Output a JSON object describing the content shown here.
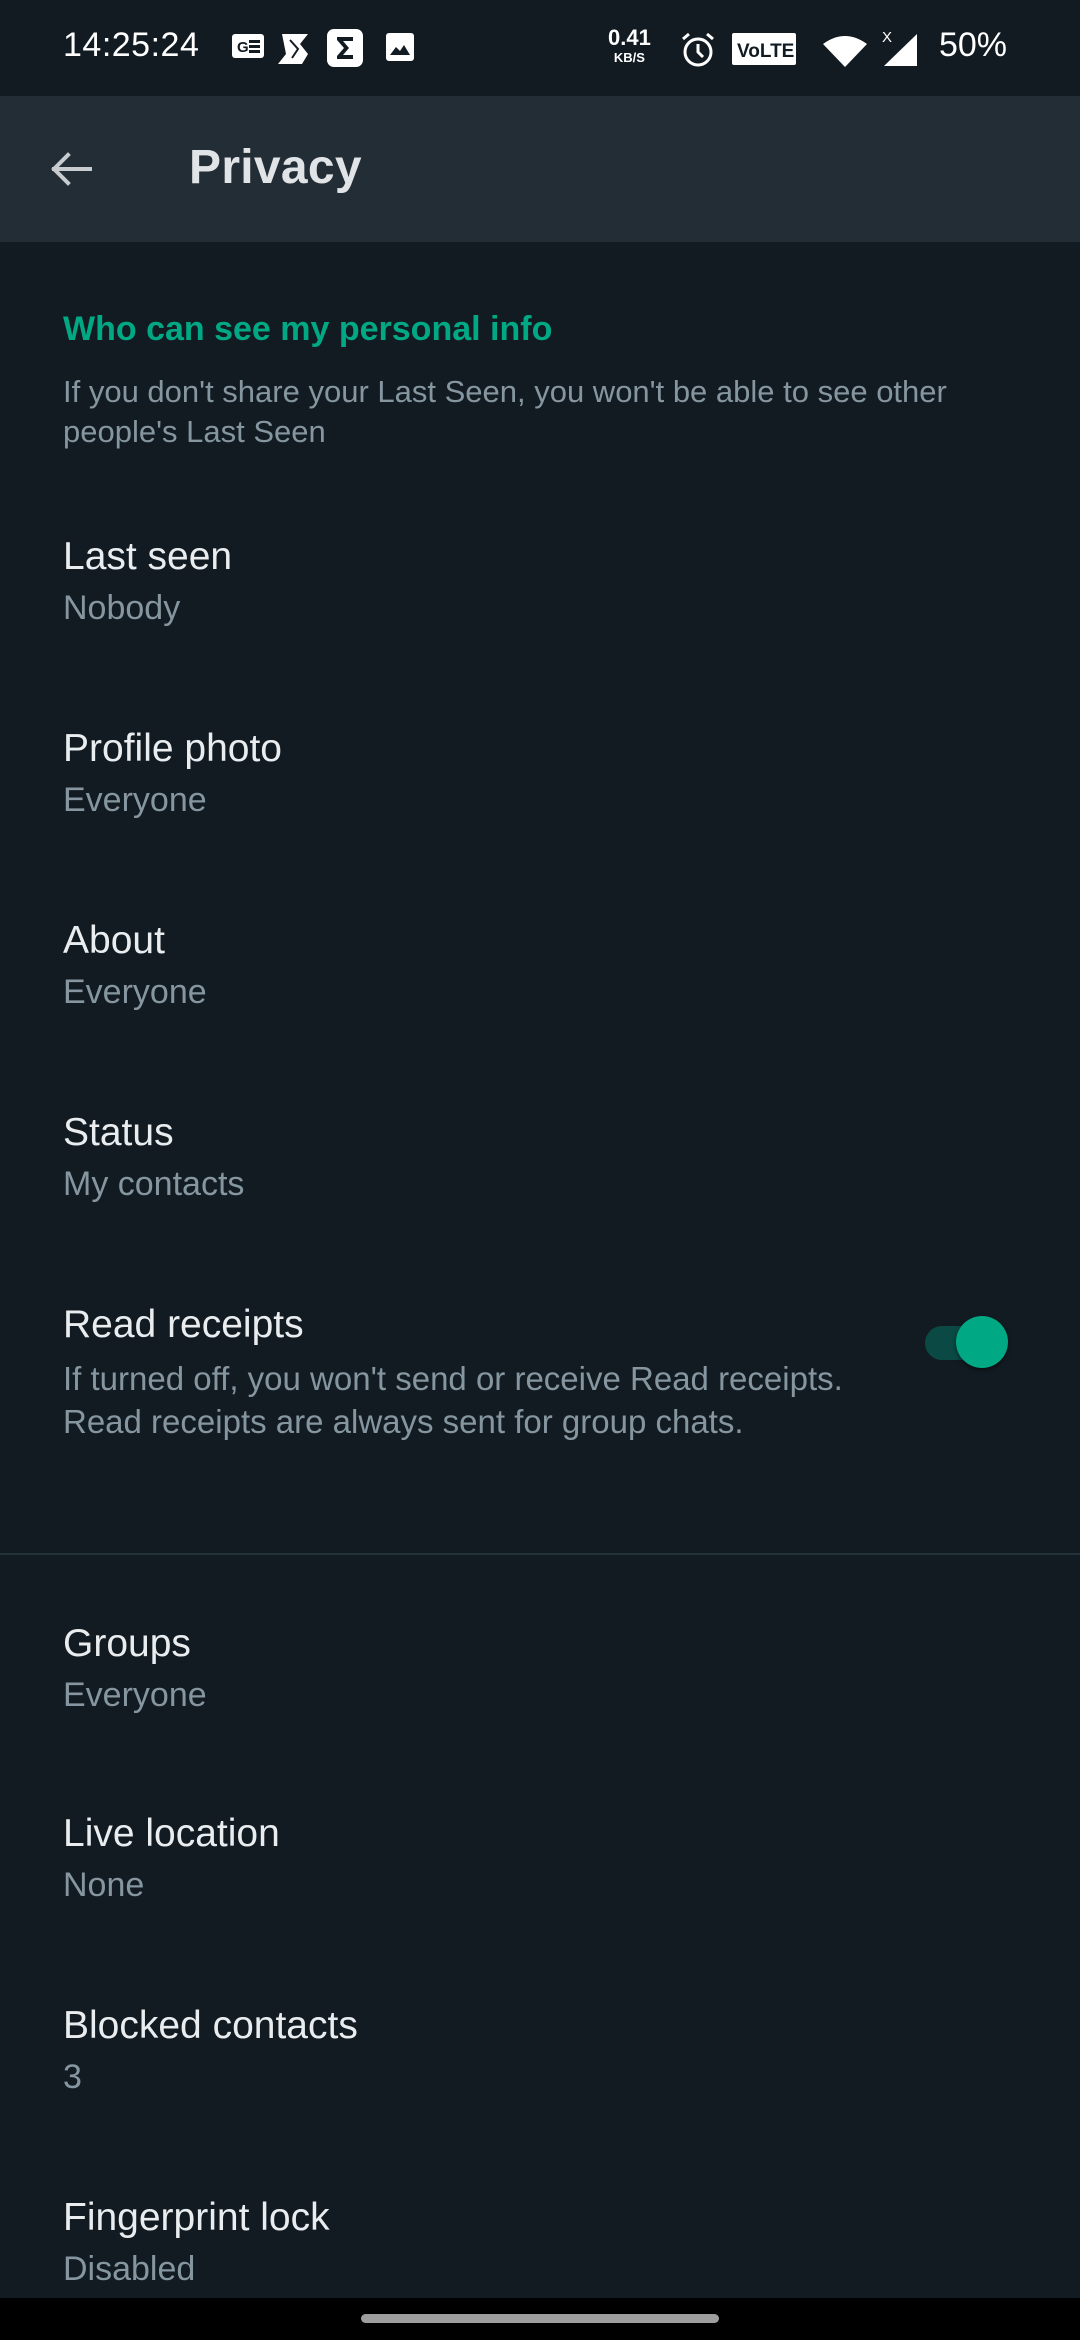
{
  "status_bar": {
    "time": "14:25:24",
    "net_speed_value": "0.41",
    "net_speed_unit": "KB/S",
    "battery": "50%",
    "notification_icons": [
      "news-icon",
      "s-app-icon",
      "sigma-app-icon",
      "gallery-icon"
    ],
    "system_icons": [
      "alarm-icon",
      "volte-icon",
      "wifi-icon",
      "signal-icon"
    ],
    "volte_label": "VoLTE",
    "signal_badge": "X"
  },
  "app_bar": {
    "title": "Privacy",
    "back_icon": "arrow-left-icon"
  },
  "section": {
    "header": "Who can see my personal info",
    "description": "If you don't share your Last Seen, you won't be able to see other people's Last Seen"
  },
  "items": [
    {
      "title": "Last seen",
      "value": "Nobody"
    },
    {
      "title": "Profile photo",
      "value": "Everyone"
    },
    {
      "title": "About",
      "value": "Everyone"
    },
    {
      "title": "Status",
      "value": "My contacts"
    }
  ],
  "read_receipts": {
    "title": "Read receipts",
    "description": "If turned off, you won't send or receive Read receipts. Read receipts are always sent for group chats.",
    "enabled": true
  },
  "items_2": [
    {
      "title": "Groups",
      "value": "Everyone"
    },
    {
      "title": "Live location",
      "value": "None"
    },
    {
      "title": "Blocked contacts",
      "value": "3"
    },
    {
      "title": "Fingerprint lock",
      "value": "Disabled"
    }
  ],
  "colors": {
    "accent": "#00a884",
    "background": "#121b22",
    "app_bar": "#232d36",
    "primary_text": "#e9edef",
    "secondary_text": "#8696a0"
  }
}
